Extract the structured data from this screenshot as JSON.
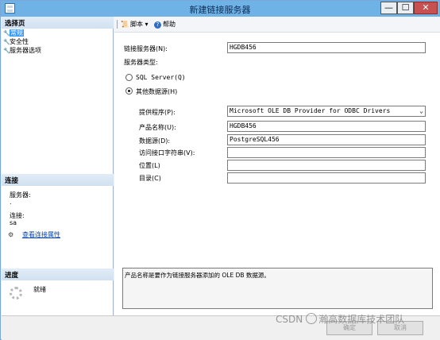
{
  "window": {
    "title": "新建链接服务器",
    "min_glyph": "—",
    "max_glyph": "☐",
    "close_glyph": "✕"
  },
  "left": {
    "select_page_header": "选择页",
    "nav_items": [
      {
        "label": "常规",
        "selected": true,
        "icon": "wrench-icon"
      },
      {
        "label": "安全性",
        "selected": false,
        "icon": "wrench-icon"
      },
      {
        "label": "服务器选项",
        "selected": false,
        "icon": "wrench-icon"
      }
    ],
    "connection_header": "连接",
    "server_label": "服务器:",
    "server_value": ".",
    "connection_label": "连接:",
    "connection_value": "sa",
    "view_connection_link": "查看连接属性",
    "progress_header": "进度",
    "progress_status": "就绪"
  },
  "toolbar": {
    "script_label": "脚本",
    "script_arrow": "▾",
    "help_label": "帮助"
  },
  "form": {
    "linked_server_label": "链接服务器(N):",
    "linked_server_value": "HGDB456",
    "server_type_label": "服务器类型:",
    "radio_sql_server": "SQL Server(Q)",
    "radio_other": "其他数据源(H)",
    "provider_label": "提供程序(P):",
    "provider_value": "Microsoft OLE DB Provider for ODBC Drivers",
    "product_label": "产品名称(U):",
    "product_value": "HGDB456",
    "datasource_label": "数据源(D):",
    "datasource_value": "PostgreSQL456",
    "provider_string_label": "访问接口字符串(V):",
    "provider_string_value": "",
    "location_label": "位置(L)",
    "location_value": "",
    "catalog_label": "目录(C)",
    "catalog_value": ""
  },
  "description": "产品名称是要作为链接服务器添加的 OLE DB 数据源。",
  "buttons": {
    "ok": "确定",
    "cancel": "取消"
  },
  "watermark": {
    "csdn": "CSDN",
    "text": "瀚高数据库技术团队"
  }
}
